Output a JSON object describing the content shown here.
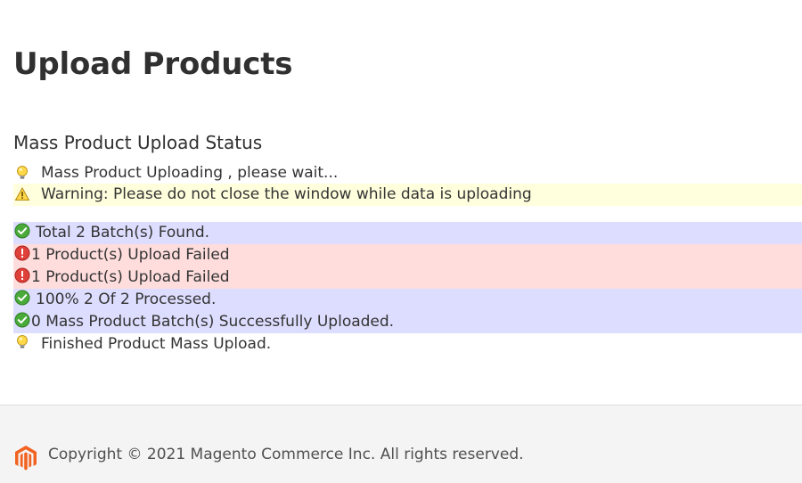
{
  "page": {
    "title": "Upload Products"
  },
  "status": {
    "heading": "Mass Product Upload Status",
    "messages": [
      {
        "text": "Mass Product Uploading , please wait...",
        "type": "note",
        "icon": "lightbulb-icon"
      },
      {
        "text": "Warning: Please do not close the window while data is uploading",
        "type": "warning",
        "icon": "warning-icon"
      },
      {
        "text": "Total 2 Batch(s) Found.",
        "type": "success",
        "icon": "check-circle-icon"
      },
      {
        "text": "1 Product(s) Upload Failed",
        "type": "error",
        "icon": "error-circle-icon"
      },
      {
        "text": "1 Product(s) Upload Failed",
        "type": "error",
        "icon": "error-circle-icon"
      },
      {
        "text": "100% 2 Of 2 Processed.",
        "type": "success",
        "icon": "check-circle-icon"
      },
      {
        "text": "0 Mass Product Batch(s) Successfully Uploaded.",
        "type": "success",
        "icon": "check-circle-icon"
      },
      {
        "text": "Finished Product Mass Upload.",
        "type": "note",
        "icon": "lightbulb-icon"
      }
    ]
  },
  "footer": {
    "copyright": "Copyright © 2021 Magento Commerce Inc. All rights reserved.",
    "logo_icon": "magento-logo-icon"
  },
  "colors": {
    "warning_bg": "#ffffdd",
    "success_bg": "#ddddff",
    "error_bg": "#ffdddd",
    "logo": "#f26322"
  }
}
